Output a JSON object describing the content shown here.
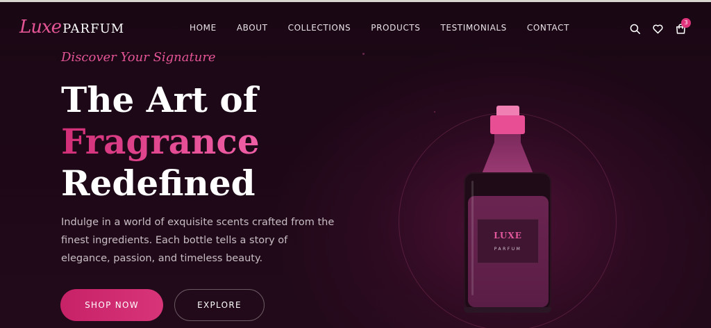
{
  "brand": {
    "script": "Luxe",
    "word": "PARFUM"
  },
  "nav": {
    "items": [
      {
        "label": "HOME"
      },
      {
        "label": "ABOUT"
      },
      {
        "label": "COLLECTIONS"
      },
      {
        "label": "PRODUCTS"
      },
      {
        "label": "TESTIMONIALS"
      },
      {
        "label": "CONTACT"
      }
    ]
  },
  "header_icons": {
    "search": "search-icon",
    "wishlist": "heart-icon",
    "cart": "shopping-bag-icon",
    "cart_count": "3"
  },
  "hero": {
    "eyebrow": "Discover Your Signature",
    "headline_line1": "The Art of",
    "headline_line2": "Fragrance",
    "headline_line3": "Redefined",
    "description": "Indulge in a world of exquisite scents crafted from the finest ingredients. Each bottle tells a story of elegance, passion, and timeless beauty.",
    "primary_button": "SHOP NOW",
    "secondary_button": "EXPLORE"
  },
  "bottle": {
    "label_brand": "LUXE",
    "label_sub": "PARFUM"
  },
  "colors": {
    "accent": "#e0357c",
    "accent_light": "#e8539a",
    "background": "#1a0714"
  }
}
